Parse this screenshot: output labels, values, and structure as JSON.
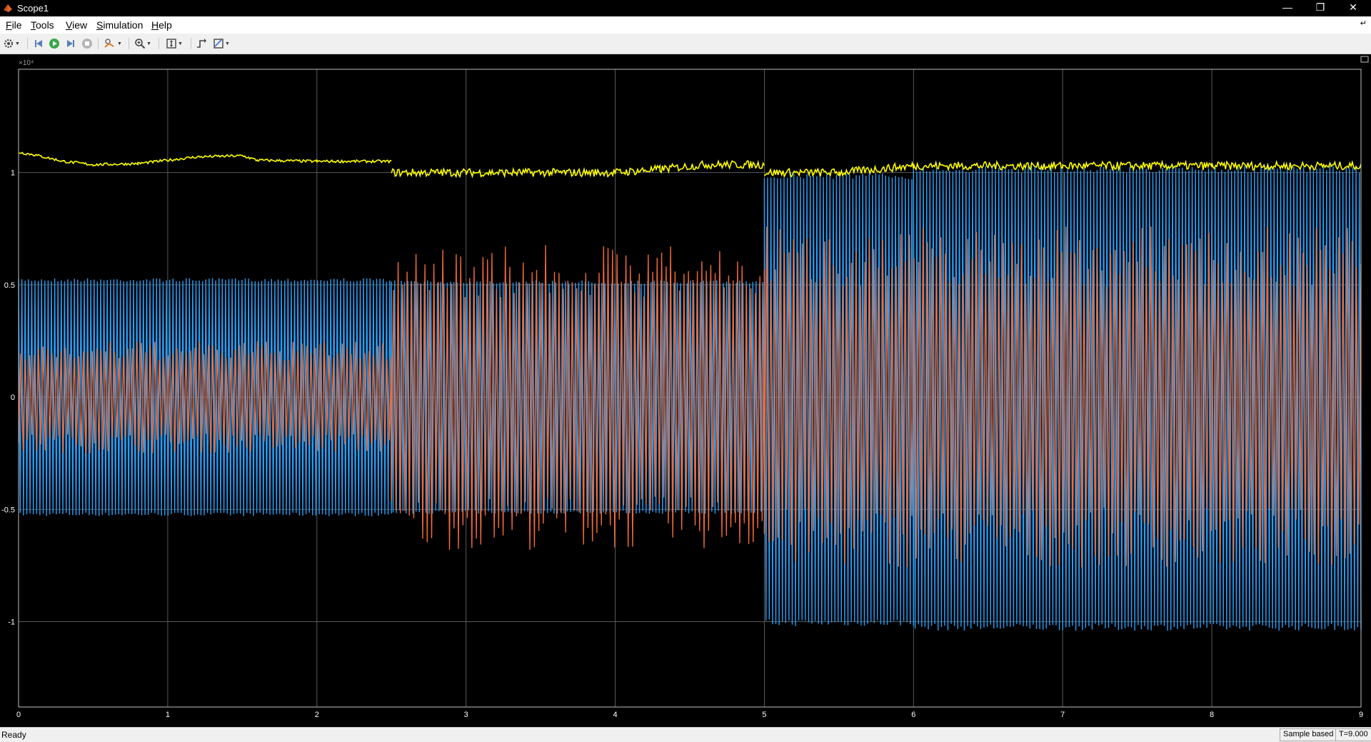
{
  "window": {
    "title": "Scope1",
    "controls": [
      "minimize",
      "restore",
      "close"
    ]
  },
  "menubar": {
    "items": [
      {
        "label": "File",
        "accel": "F",
        "rest": "ile"
      },
      {
        "label": "Tools",
        "accel": "T",
        "rest": "ools"
      },
      {
        "label": "View",
        "accel": "V",
        "rest": "iew"
      },
      {
        "label": "Simulation",
        "accel": "S",
        "rest": "imulation"
      },
      {
        "label": "Help",
        "accel": "H",
        "rest": "elp"
      }
    ]
  },
  "toolbar": {
    "buttons": [
      "settings-icon",
      "step-back-icon",
      "run-icon",
      "step-forward-icon",
      "stop-icon",
      "highlight-icon",
      "zoom-in-icon",
      "scale-axes-icon",
      "triggers-icon",
      "cursor-measure-icon"
    ]
  },
  "colors": {
    "background": "#000000",
    "grid": "#5a5a5a",
    "axes_text": "#ffffff",
    "series_yellow": "#ffff00",
    "series_blue": "#2a9df4",
    "series_orange": "#f06a38"
  },
  "chart_data": {
    "type": "line",
    "title": "",
    "xlabel": "",
    "ylabel": "",
    "y_exponent_label": "×10⁴",
    "xlim": [
      0,
      9
    ],
    "ylim": [
      -1.38,
      1.46
    ],
    "y_scale_factor": 10000,
    "x_ticks": [
      0,
      1,
      2,
      3,
      4,
      5,
      6,
      7,
      8,
      9
    ],
    "x_tick_labels": [
      "0",
      "1",
      "2",
      "3",
      "4",
      "5",
      "6",
      "7",
      "8",
      "9"
    ],
    "y_ticks": [
      1,
      0.5,
      0,
      -0.5,
      -1
    ],
    "y_tick_labels": [
      "1",
      "0.5",
      "0",
      "-0.5",
      "-1"
    ],
    "grid": true,
    "series": [
      {
        "color": "#ffff00",
        "segments": [
          {
            "x": [
              0,
              0.1,
              0.3,
              0.5,
              0.8,
              1.2,
              1.5,
              1.6,
              2.0,
              2.5
            ],
            "y": [
              1.09,
              1.08,
              1.05,
              1.035,
              1.04,
              1.07,
              1.075,
              1.055,
              1.05,
              1.05
            ]
          },
          {
            "x": [
              2.5,
              3.0,
              4.0,
              4.3,
              4.6,
              5.0
            ],
            "y": [
              1.0,
              1.0,
              1.0,
              1.015,
              1.035,
              1.035
            ]
          },
          {
            "x": [
              5.0,
              5.5,
              6.0,
              7.0,
              8.0,
              9.0
            ],
            "y": [
              1.0,
              1.0,
              1.03,
              1.03,
              1.03,
              1.03
            ]
          }
        ]
      },
      {
        "color": "#2a9df4",
        "envelope": [
          {
            "x0": 0,
            "x1": 2.5,
            "upper": 0.53,
            "lower": -0.53
          },
          {
            "x0": 2.5,
            "x1": 5.0,
            "upper": 0.52,
            "lower": -0.52
          },
          {
            "x0": 5.0,
            "x1": 6.0,
            "upper": 1.0,
            "lower": -1.02
          },
          {
            "x0": 6.0,
            "x1": 9.0,
            "upper": 1.03,
            "lower": -1.04
          }
        ]
      },
      {
        "color": "#f06a38",
        "envelope": [
          {
            "x0": 0,
            "x1": 2.5,
            "upper": 0.25,
            "lower": -0.25
          },
          {
            "x0": 2.5,
            "x1": 5.0,
            "upper": 0.68,
            "lower": -0.68
          },
          {
            "x0": 5.0,
            "x1": 9.0,
            "upper": 0.76,
            "lower": -0.76
          }
        ]
      }
    ]
  },
  "statusbar": {
    "ready": "Ready",
    "mode": "Sample based",
    "time": "T=9.000"
  }
}
